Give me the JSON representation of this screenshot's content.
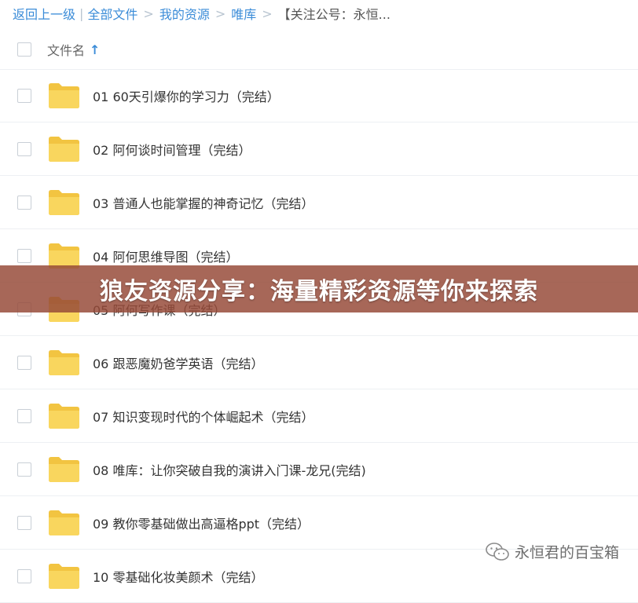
{
  "breadcrumb": {
    "back": "返回上一级",
    "all_files": "全部文件",
    "my_resources": "我的资源",
    "weiku": "唯库",
    "current": "【关注公号：永恒..."
  },
  "header": {
    "name_label": "文件名"
  },
  "files": [
    "01 60天引爆你的学习力（完结）",
    "02 阿何谈时间管理（完结）",
    "03 普通人也能掌握的神奇记忆（完结）",
    "04 阿何思维导图（完结）",
    "05 阿何写作课（完结）",
    "06 跟恶魔奶爸学英语（完结）",
    "07 知识变现时代的个体崛起术（完结）",
    "08 唯库：让你突破自我的演讲入门课-龙兄(完结)",
    "09 教你零基础做出高逼格ppt（完结）",
    "10 零基础化妆美颜术（完结）"
  ],
  "banner": {
    "text": "狼友资源分享：海量精彩资源等你来探索"
  },
  "watermark": {
    "text": "永恒君的百宝箱"
  },
  "colors": {
    "link": "#3b8cd8",
    "folder": "#f7d35b",
    "banner": "#964a38"
  }
}
